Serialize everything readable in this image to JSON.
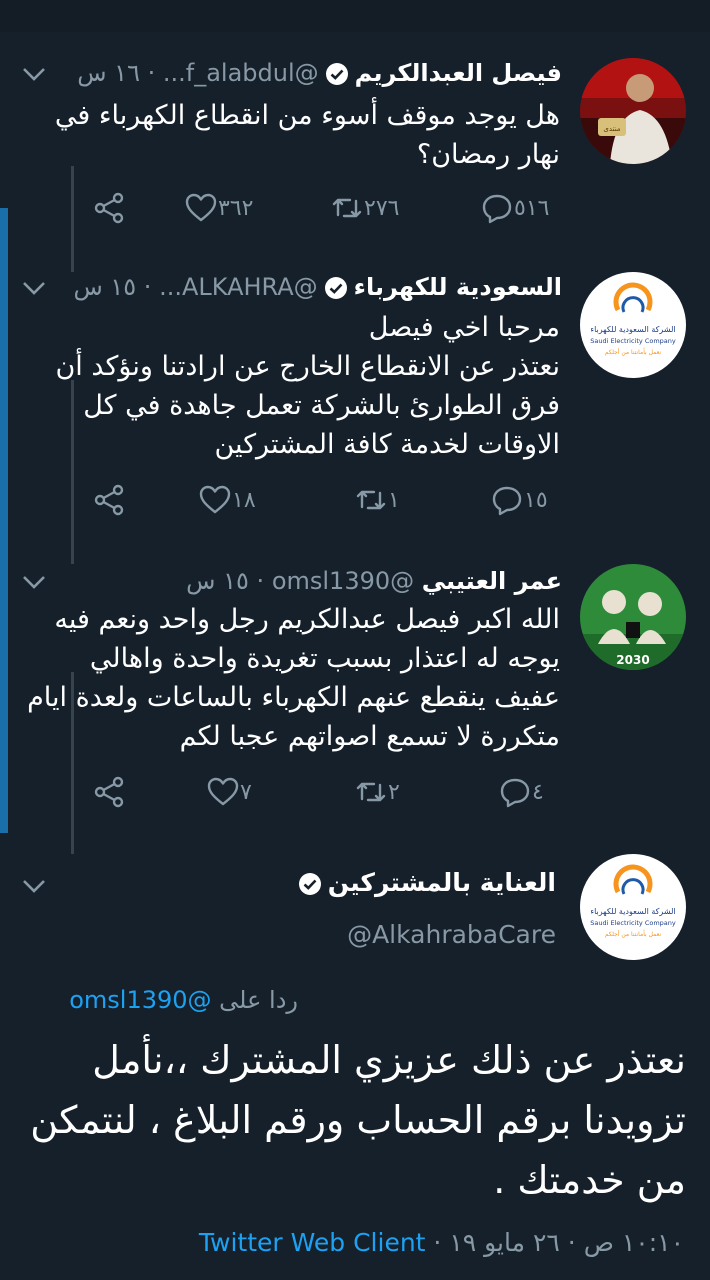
{
  "tweets": [
    {
      "name": "فيصل العبدالكريم",
      "handle": "@f_alabdul...",
      "time": "١٦ س",
      "text": "هل يوجد موقف أسوء من انقطاع الكهرباء في نهار رمضان؟",
      "replies": "٥١٦",
      "retweets": "٢٧٦",
      "likes": "٣٦٢"
    },
    {
      "name": "السعودية للكهرباء",
      "handle": "@ALKAHRA...",
      "time": "١٥ س",
      "text_lines": [
        "مرحبا اخي فيصل",
        "نعتذر عن الانقطاع الخارج عن ارادتنا ونؤكد أن فرق الطوارئ بالشركة تعمل جاهدة في كل الاوقات لخدمة كافة المشتركين"
      ],
      "replies": "١٥",
      "retweets": "١",
      "likes": "١٨",
      "avatar_text": {
        "ar": "الشركة السعودية للكهرباء",
        "en": "Saudi Electricity Company",
        "sub": "نعمل بأمانتنا من أجلكم"
      }
    },
    {
      "name": "عمر العتيبي",
      "handle": "@omsl1390",
      "time": "١٥ س",
      "text": "الله اكبر فيصل عبدالكريم رجل واحد ونعم فيه يوجه له اعتذار  بسبب تغريدة واحدة واهالي عفيف ينقطع عنهم الكهرباء بالساعات ولعدة ايام متكررة لا تسمع اصواتهم عجبا لكم",
      "replies": "٤",
      "retweets": "٢",
      "likes": "٧",
      "avatar_text": {
        "year": "2030"
      }
    }
  ],
  "main": {
    "name": "العناية بالمشتركين",
    "handle": "@AlkahrabaCare",
    "replying_label": "ردا على",
    "replying_to": "@omsl1390",
    "text": "نعتذر عن ذلك  عزيزي المشترك ،،نأمل تزويدنا برقم الحساب ورقم البلاغ  ، لنتمكن من خدمتك .",
    "time": "١٠:١٠ ص",
    "date": "٢٦ مايو ١٩",
    "client": "Twitter Web Client",
    "sep": "·"
  },
  "icons": [
    "verified-badge-icon",
    "chevron-down-icon",
    "reply-icon",
    "retweet-icon",
    "like-icon",
    "share-icon"
  ],
  "colors": {
    "background": "#15202b",
    "muted": "#8899a6",
    "link": "#1da1f2",
    "thread_line": "#38444d"
  }
}
